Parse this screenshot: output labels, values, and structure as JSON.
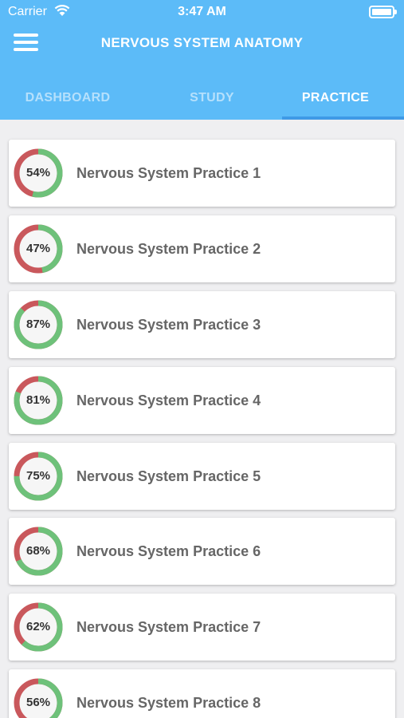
{
  "status_bar": {
    "carrier": "Carrier",
    "time": "3:47 AM"
  },
  "header": {
    "title": "NERVOUS SYSTEM ANATOMY"
  },
  "tabs": [
    {
      "label": "DASHBOARD",
      "active": false
    },
    {
      "label": "STUDY",
      "active": false
    },
    {
      "label": "PRACTICE",
      "active": true
    }
  ],
  "colors": {
    "header": "#5cbbf8",
    "correct": "#6ec17a",
    "incorrect": "#c9585c",
    "ring_inner": "#f6f6f6"
  },
  "practices": [
    {
      "title": "Nervous System Practice 1",
      "percent_label": "54%",
      "percent": 54
    },
    {
      "title": "Nervous System Practice 2",
      "percent_label": "47%",
      "percent": 47
    },
    {
      "title": "Nervous System Practice 3",
      "percent_label": "87%",
      "percent": 87
    },
    {
      "title": "Nervous System Practice 4",
      "percent_label": "81%",
      "percent": 81
    },
    {
      "title": "Nervous System Practice 5",
      "percent_label": "75%",
      "percent": 75
    },
    {
      "title": "Nervous System Practice 6",
      "percent_label": "68%",
      "percent": 68
    },
    {
      "title": "Nervous System Practice 7",
      "percent_label": "62%",
      "percent": 62
    },
    {
      "title": "Nervous System Practice 8",
      "percent_label": "56%",
      "percent": 56
    }
  ]
}
